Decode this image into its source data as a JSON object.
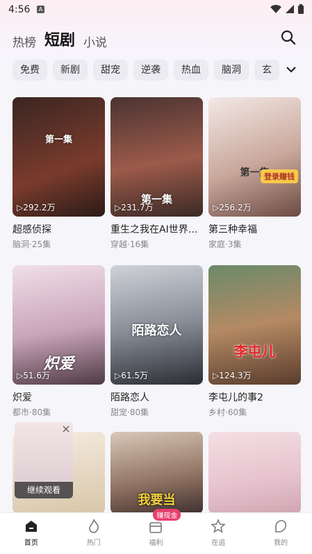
{
  "status": {
    "time": "4:56",
    "app_icon": "A"
  },
  "top_tabs": [
    "热榜",
    "短剧",
    "小说"
  ],
  "chips": [
    "免费",
    "新剧",
    "甜宠",
    "逆袭",
    "热血",
    "脑洞",
    "玄"
  ],
  "cards": [
    {
      "title": "超感侦探",
      "meta": "脑洞·25集",
      "plays": "▷292.2万",
      "poster_text": "第一集"
    },
    {
      "title": "重生之我在AI世界…",
      "meta": "穿越·16集",
      "plays": "▷231.7万",
      "poster_text": "第一集"
    },
    {
      "title": "第三种幸福",
      "meta": "家庭·3集",
      "plays": "▷256.2万",
      "poster_text": "第一集",
      "badge": "登录赚钱"
    },
    {
      "title": "炽爱",
      "meta": "都市·80集",
      "plays": "▷51.6万",
      "poster_text": "炽爱"
    },
    {
      "title": "陌路恋人",
      "meta": "甜宠·80集",
      "plays": "▷61.5万",
      "poster_text": "陌路恋人"
    },
    {
      "title": "李屯儿的事2",
      "meta": "乡村·60集",
      "plays": "▷124.3万",
      "poster_text": "李屯儿"
    },
    {
      "poster_text": ""
    },
    {
      "poster_text": "我要当"
    },
    {
      "poster_text": ""
    }
  ],
  "continue_watching": "继续观看",
  "nav": [
    {
      "label": "首页",
      "icon": "home-icon"
    },
    {
      "label": "热门",
      "icon": "flame-icon"
    },
    {
      "label": "福利",
      "icon": "gift-icon",
      "badge": "赚现金"
    },
    {
      "label": "在追",
      "icon": "star-icon"
    },
    {
      "label": "我的",
      "icon": "profile-icon"
    }
  ]
}
